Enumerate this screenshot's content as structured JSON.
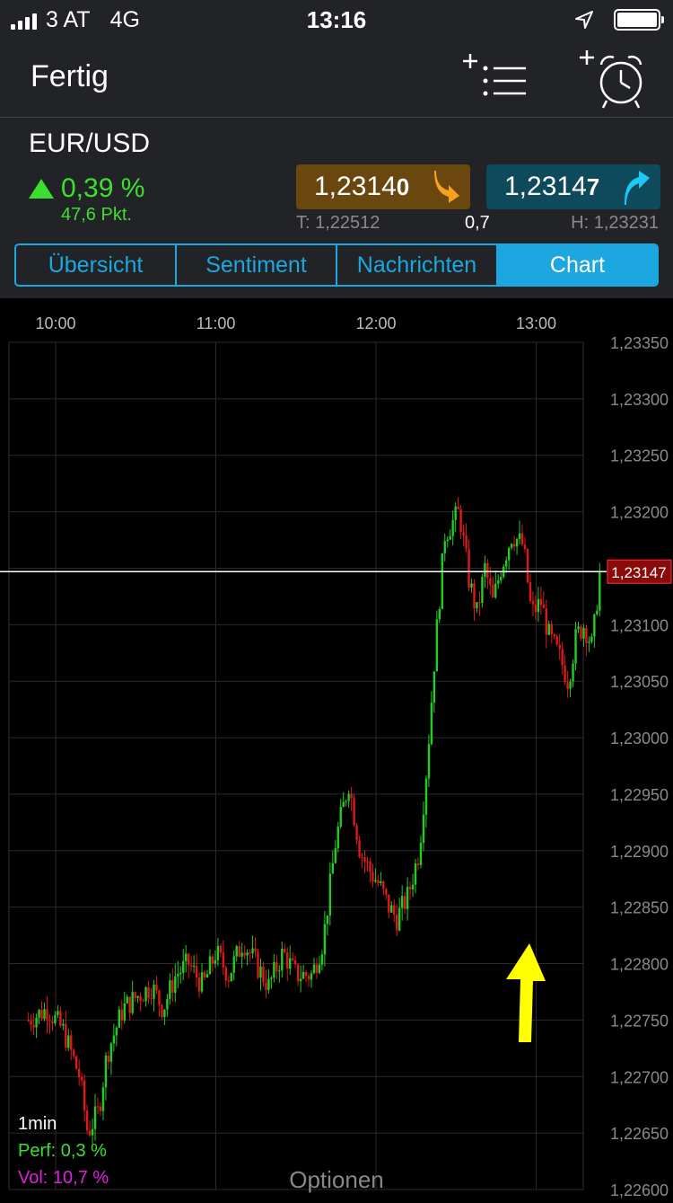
{
  "status": {
    "carrier": "3 AT",
    "network": "4G",
    "time": "13:16"
  },
  "nav": {
    "done": "Fertig",
    "watchlist_icon": "add-to-list-icon",
    "alarm_icon": "add-alarm-icon"
  },
  "instrument": {
    "pair": "EUR/USD",
    "change": "0,39 %",
    "points": "47,6 Pkt.",
    "bid_main": "1,2314",
    "bid_small": "0",
    "ask_main": "1,2314",
    "ask_small": "7",
    "low": "T: 1,22512",
    "spread": "0,7",
    "high": "H: 1,23231",
    "colors": {
      "up": "#3be02e",
      "bid_bg": "#6b4710",
      "ask_bg": "#0e4a5c",
      "accent": "#1ca7e0"
    }
  },
  "tabs": [
    {
      "label": "Übersicht",
      "active": false
    },
    {
      "label": "Sentiment",
      "active": false
    },
    {
      "label": "Nachrichten",
      "active": false
    },
    {
      "label": "Chart",
      "active": true
    }
  ],
  "chart_data": {
    "type": "candlestick",
    "interval": "1min",
    "x_ticks": [
      "10:00",
      "11:00",
      "12:00",
      "13:00"
    ],
    "y_ticks": [
      "1,23350",
      "1,23300",
      "1,23250",
      "1,23200",
      "1,23150",
      "1,23100",
      "1,23050",
      "1,23000",
      "1,22950",
      "1,22900",
      "1,22850",
      "1,22800",
      "1,22750",
      "1,22700",
      "1,22650",
      "1,22600"
    ],
    "ylim": [
      1.226,
      1.2335
    ],
    "current_price": 1.23147,
    "current_label": "1,23147",
    "grid": true,
    "close_path": [
      [
        9.83,
        1.2275
      ],
      [
        9.95,
        1.2276
      ],
      [
        10.05,
        1.2274
      ],
      [
        10.15,
        1.227
      ],
      [
        10.2,
        1.2265
      ],
      [
        10.27,
        1.2267
      ],
      [
        10.32,
        1.2272
      ],
      [
        10.42,
        1.2276
      ],
      [
        10.5,
        1.2277
      ],
      [
        10.6,
        1.2278
      ],
      [
        10.67,
        1.2276
      ],
      [
        10.75,
        1.2279
      ],
      [
        10.83,
        1.228
      ],
      [
        10.92,
        1.2278
      ],
      [
        11.0,
        1.2281
      ],
      [
        11.08,
        1.2279
      ],
      [
        11.17,
        1.2282
      ],
      [
        11.25,
        1.228
      ],
      [
        11.33,
        1.2278
      ],
      [
        11.42,
        1.2281
      ],
      [
        11.5,
        1.2279
      ],
      [
        11.6,
        1.2279
      ],
      [
        11.67,
        1.2282
      ],
      [
        11.75,
        1.2291
      ],
      [
        11.83,
        1.2296
      ],
      [
        11.9,
        1.229
      ],
      [
        11.97,
        1.2288
      ],
      [
        12.02,
        1.2287
      ],
      [
        12.08,
        1.2285
      ],
      [
        12.13,
        1.2284
      ],
      [
        12.2,
        1.2286
      ],
      [
        12.27,
        1.229
      ],
      [
        12.32,
        1.2298
      ],
      [
        12.37,
        1.2308
      ],
      [
        12.43,
        1.2318
      ],
      [
        12.52,
        1.232
      ],
      [
        12.58,
        1.2314
      ],
      [
        12.63,
        1.2311
      ],
      [
        12.68,
        1.2315
      ],
      [
        12.73,
        1.2312
      ],
      [
        12.78,
        1.2315
      ],
      [
        12.85,
        1.2318
      ],
      [
        12.92,
        1.2317
      ],
      [
        12.97,
        1.2311
      ],
      [
        13.03,
        1.2312
      ],
      [
        13.08,
        1.2309
      ],
      [
        13.15,
        1.2307
      ],
      [
        13.2,
        1.2305
      ],
      [
        13.25,
        1.2309
      ],
      [
        13.3,
        1.231
      ],
      [
        13.35,
        1.2308
      ],
      [
        13.4,
        1.2315
      ]
    ]
  },
  "legend": {
    "interval": "1min",
    "perf": "Perf: 0,3 %",
    "vol": "Vol: 10,7 %",
    "perf_color": "#3be02e",
    "vol_color": "#e020e0"
  },
  "annotation": {
    "arrow_color": "#ffff00"
  },
  "footer": {
    "options": "Optionen"
  }
}
